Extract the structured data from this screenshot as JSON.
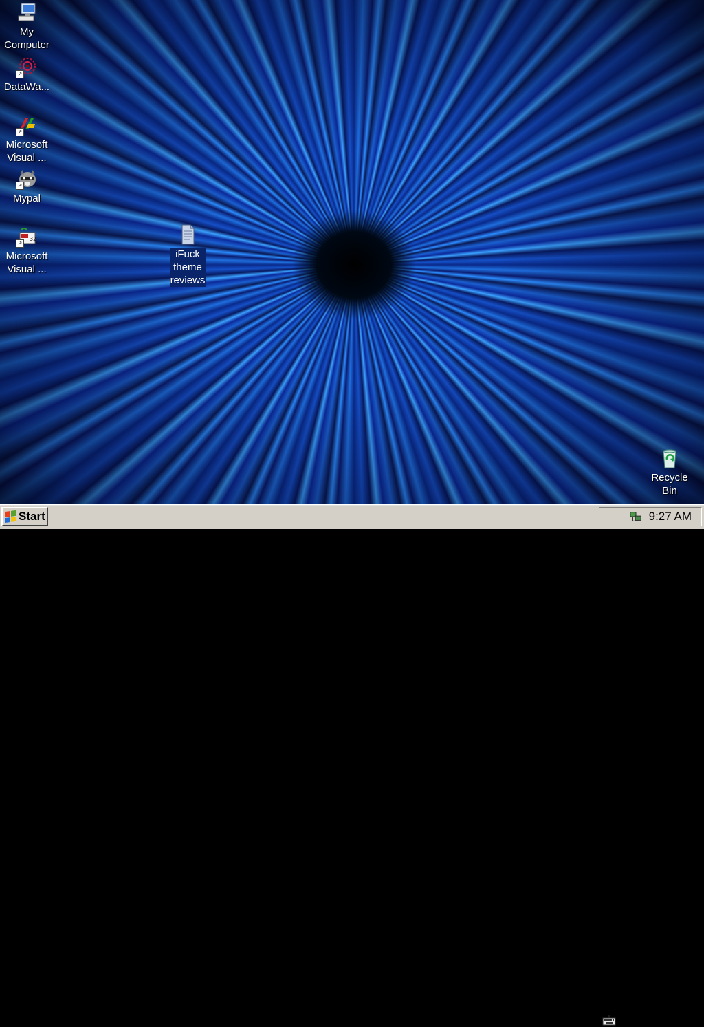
{
  "desktop": {
    "icons": [
      {
        "label": "My\nComputer",
        "type": "computer-icon"
      },
      {
        "label": "DataWa...",
        "type": "datawarehouse-icon"
      },
      {
        "label": "Microsoft\nVisual ...",
        "type": "visual-studio-icon"
      },
      {
        "label": "Mypal",
        "type": "raccoon-browser-icon"
      },
      {
        "label": "Microsoft\nVisual ...",
        "type": "visual-basic-icon"
      },
      {
        "label": "iFuck\ntheme\nreviews",
        "type": "text-document-icon"
      },
      {
        "label": "Recycle\nBin",
        "type": "recycle-bin-icon"
      }
    ]
  },
  "taskbar": {
    "start_label": "Start",
    "clock": "9:27 AM",
    "tray_icons": [
      "keyboard-icon",
      "network-icon"
    ]
  },
  "colors": {
    "taskbar": "#d4d0c8",
    "selection": "#0a246a",
    "wallpaper_accent": "#2b8cff"
  }
}
